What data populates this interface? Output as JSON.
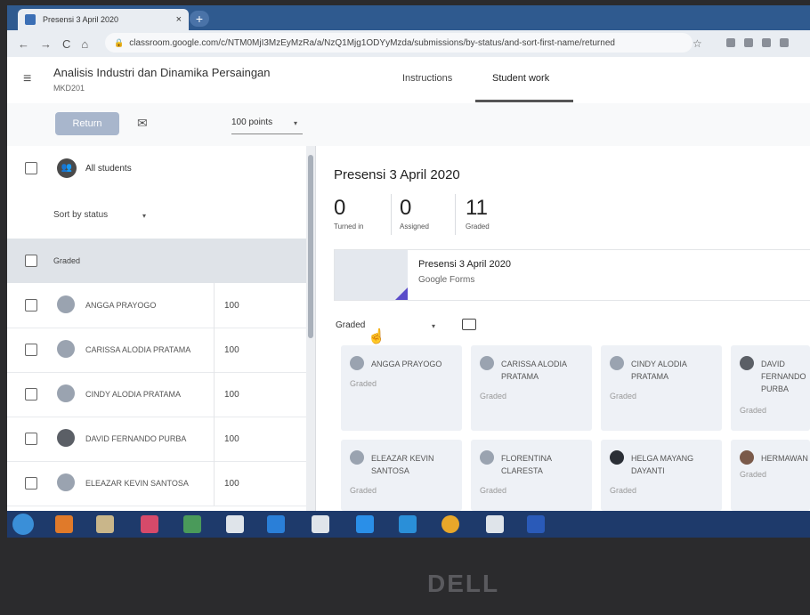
{
  "browser": {
    "tab_title": "Presensi 3 April 2020",
    "tab_close": "×",
    "new_tab": "+",
    "back": "←",
    "forward": "→",
    "reload": "C",
    "home": "⌂",
    "url": "classroom.google.com/c/NTM0MjI3MzEyMzRa/a/NzQ1Mjg1ODYyMzda/submissions/by-status/and-sort-first-name/returned",
    "bookmark_star": "☆"
  },
  "header": {
    "menu_icon": "≡",
    "class_title": "Analisis Industri dan Dinamika Persaingan",
    "class_code": "MKD201",
    "tabs": [
      {
        "label": "Instructions"
      },
      {
        "label": "Student work"
      }
    ]
  },
  "toolbar": {
    "return_label": "Return",
    "mail_icon": "✉",
    "points": "100 points",
    "points_caret": "▾"
  },
  "left_panel": {
    "all_students": "All students",
    "sort_label": "Sort by status",
    "sort_caret": "▾",
    "group_label": "Graded",
    "students": [
      {
        "name": "ANGGA PRAYOGO",
        "score": "100"
      },
      {
        "name": "CARISSA ALODIA PRATAMA",
        "score": "100"
      },
      {
        "name": "CINDY ALODIA PRATAMA",
        "score": "100"
      },
      {
        "name": "DAVID FERNANDO PURBA",
        "score": "100"
      },
      {
        "name": "ELEAZAR KEVIN SANTOSA",
        "score": "100"
      }
    ]
  },
  "right_panel": {
    "assignment_title": "Presensi 3 April 2020",
    "stats": [
      {
        "num": "0",
        "label": "Turned in"
      },
      {
        "num": "0",
        "label": "Assigned"
      },
      {
        "num": "11",
        "label": "Graded"
      }
    ],
    "attachment": {
      "title": "Presensi 3 April 2020",
      "subtitle": "Google Forms"
    },
    "filter_label": "Graded",
    "filter_caret": "▾",
    "cards": [
      {
        "name": "ANGGA PRAYOGO",
        "status": "Graded"
      },
      {
        "name": "CARISSA ALODIA PRATAMA",
        "status": "Graded"
      },
      {
        "name": "CINDY ALODIA PRATAMA",
        "status": "Graded"
      },
      {
        "name": "DAVID FERNANDO PURBA",
        "status": "Graded"
      },
      {
        "name": "ELEAZAR KEVIN SANTOSA",
        "status": "Graded"
      },
      {
        "name": "FLORENTINA CLARESTA",
        "status": "Graded"
      },
      {
        "name": "HELGA MAYANG DAYANTI",
        "status": "Graded"
      },
      {
        "name": "HERMAWAN",
        "status": "Graded"
      }
    ]
  },
  "laptop": {
    "brand": "DELL"
  },
  "colors": {
    "tabbar": "#2f5a8f",
    "return_button": "#a8b6cc",
    "taskbar": "#1e3a6b",
    "forms_accent": "#5a4cc9"
  }
}
